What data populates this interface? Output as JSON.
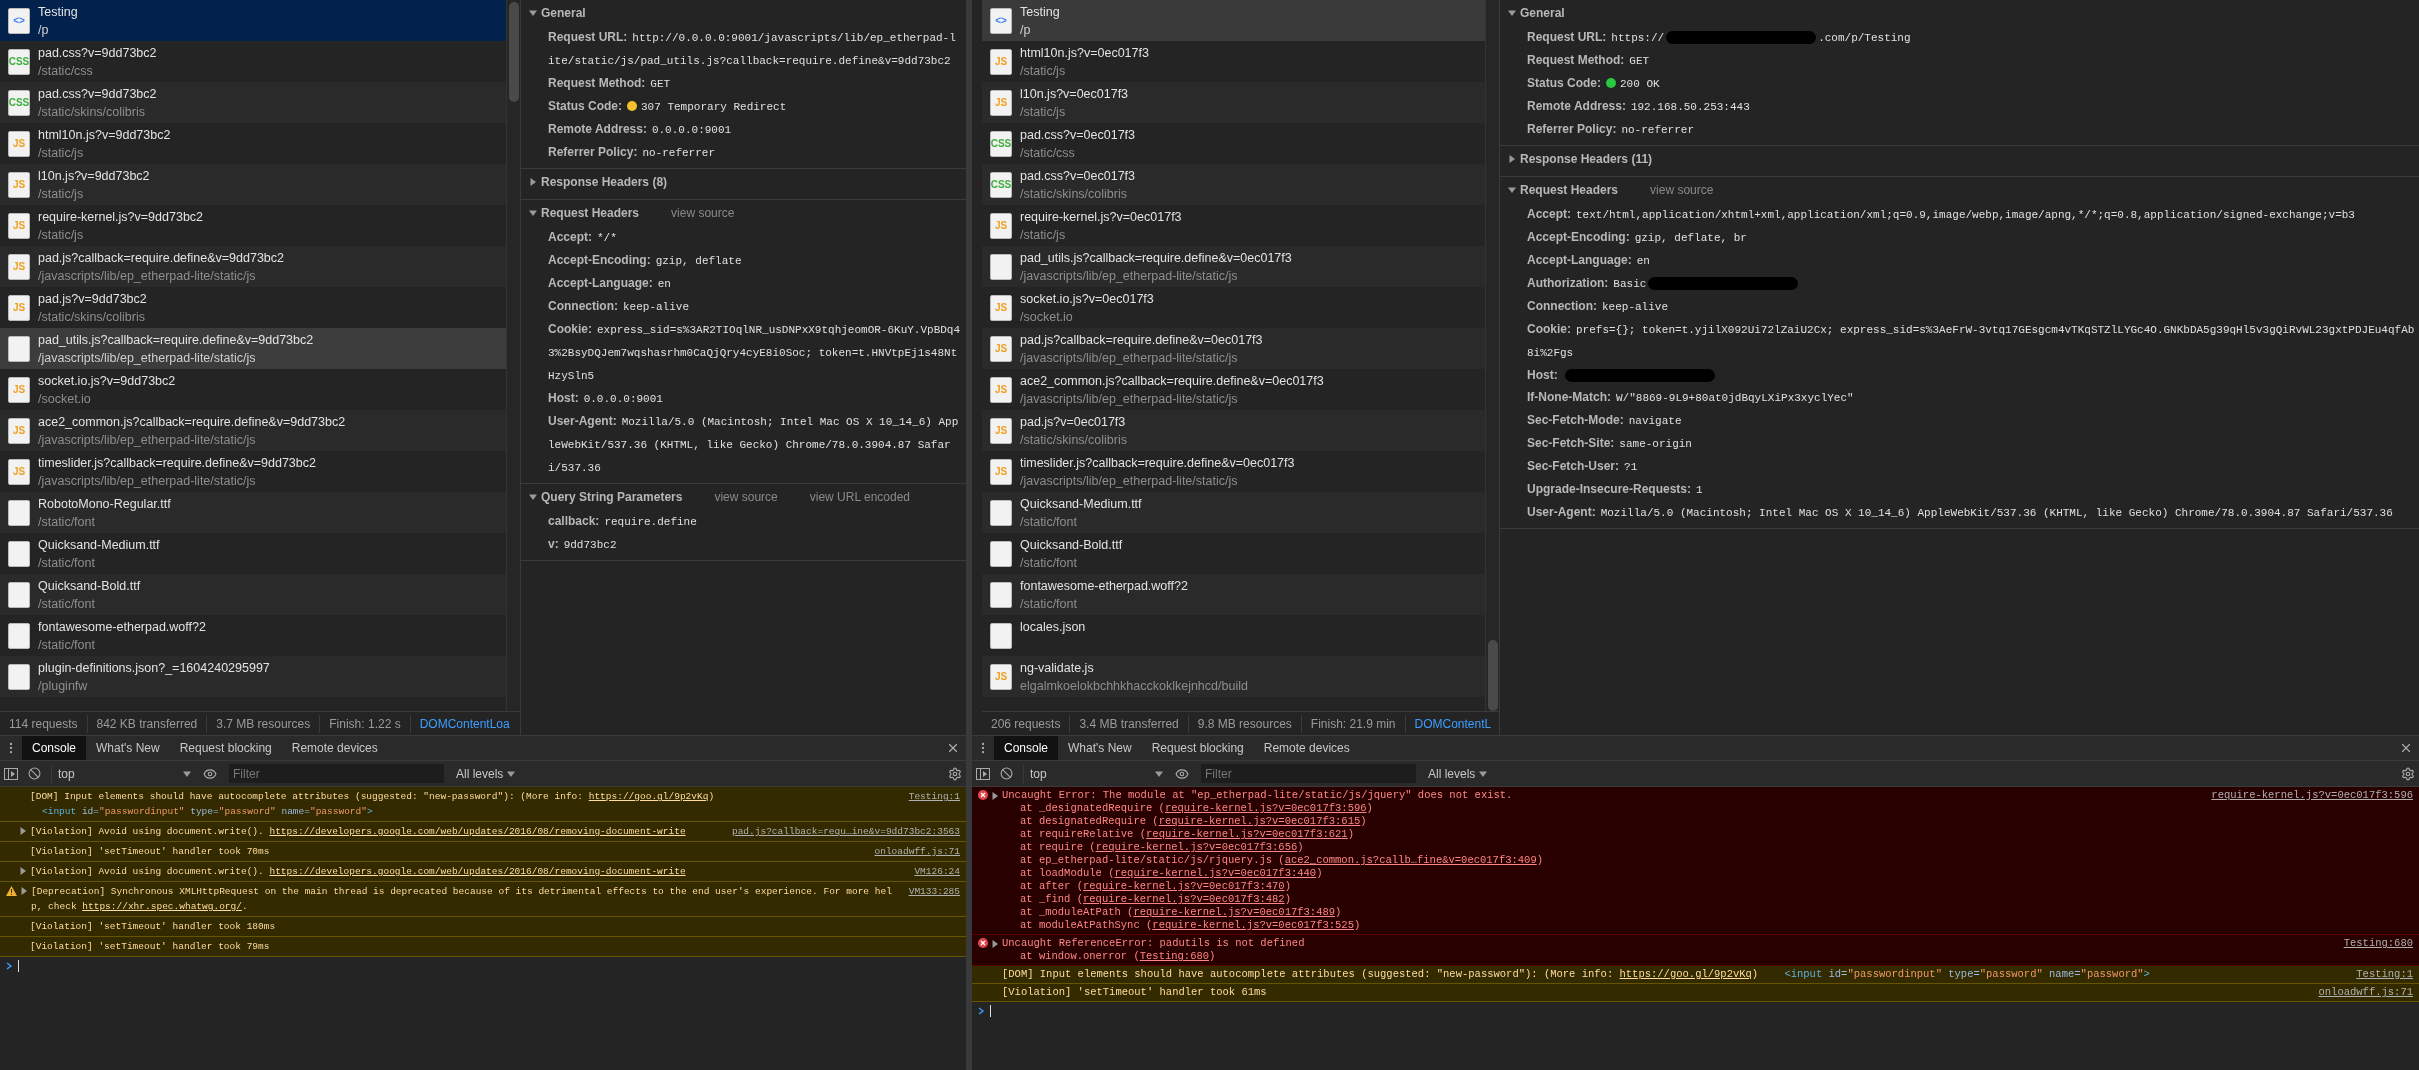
{
  "panes": [
    {
      "list_focused": true,
      "requests": [
        {
          "name": "Testing",
          "path": "/p",
          "kind": "html",
          "icon_label": "<>",
          "selected": true,
          "hovered": false
        },
        {
          "name": "pad.css?v=9dd73bc2",
          "path": "/static/css",
          "kind": "css",
          "icon_label": "CSS",
          "selected": false,
          "hovered": false
        },
        {
          "name": "pad.css?v=9dd73bc2",
          "path": "/static/skins/colibris",
          "kind": "css",
          "icon_label": "CSS",
          "selected": false,
          "hovered": false
        },
        {
          "name": "html10n.js?v=9dd73bc2",
          "path": "/static/js",
          "kind": "js",
          "icon_label": "JS",
          "selected": false,
          "hovered": false
        },
        {
          "name": "l10n.js?v=9dd73bc2",
          "path": "/static/js",
          "kind": "js",
          "icon_label": "JS",
          "selected": false,
          "hovered": false
        },
        {
          "name": "require-kernel.js?v=9dd73bc2",
          "path": "/static/js",
          "kind": "js",
          "icon_label": "JS",
          "selected": false,
          "hovered": false
        },
        {
          "name": "pad.js?callback=require.define&v=9dd73bc2",
          "path": "/javascripts/lib/ep_etherpad-lite/static/js",
          "kind": "js",
          "icon_label": "JS",
          "selected": false,
          "hovered": false
        },
        {
          "name": "pad.js?v=9dd73bc2",
          "path": "/static/skins/colibris",
          "kind": "js",
          "icon_label": "JS",
          "selected": false,
          "hovered": false
        },
        {
          "name": "pad_utils.js?callback=require.define&v=9dd73bc2",
          "path": "/javascripts/lib/ep_etherpad-lite/static/js",
          "kind": "other",
          "selected": false,
          "hovered": true
        },
        {
          "name": "socket.io.js?v=9dd73bc2",
          "path": "/socket.io",
          "kind": "js",
          "icon_label": "JS",
          "selected": false,
          "hovered": false
        },
        {
          "name": "ace2_common.js?callback=require.define&v=9dd73bc2",
          "path": "/javascripts/lib/ep_etherpad-lite/static/js",
          "kind": "js",
          "icon_label": "JS",
          "selected": false,
          "hovered": false
        },
        {
          "name": "timeslider.js?callback=require.define&v=9dd73bc2",
          "path": "/javascripts/lib/ep_etherpad-lite/static/js",
          "kind": "js",
          "icon_label": "JS",
          "selected": false,
          "hovered": false
        },
        {
          "name": "RobotoMono-Regular.ttf",
          "path": "/static/font",
          "kind": "other",
          "selected": false,
          "hovered": false
        },
        {
          "name": "Quicksand-Medium.ttf",
          "path": "/static/font",
          "kind": "other",
          "selected": false,
          "hovered": false
        },
        {
          "name": "Quicksand-Bold.ttf",
          "path": "/static/font",
          "kind": "other",
          "selected": false,
          "hovered": false
        },
        {
          "name": "fontawesome-etherpad.woff?2",
          "path": "/static/font",
          "kind": "other",
          "selected": false,
          "hovered": false
        },
        {
          "name": "plugin-definitions.json?_=1604240295997",
          "path": "/pluginfw",
          "kind": "other",
          "selected": false,
          "hovered": false
        }
      ],
      "summary": [
        "114 requests",
        "842 KB transferred",
        "3.7 MB resources",
        "Finish: 1.22 s"
      ],
      "summary_link": "DOMContentLoa",
      "sections": [
        {
          "title": "General",
          "expanded": true,
          "rows": [
            {
              "key": "Request URL:",
              "value": "http://0.0.0.0:9001/javascripts/lib/ep_etherpad-lite/static/js/pad_utils.js?callback=require.define&v=9dd73bc2"
            },
            {
              "key": "Request Method:",
              "value": "GET"
            },
            {
              "key": "Status Code:",
              "value": "307 Temporary Redirect",
              "color": "#f5c22c"
            },
            {
              "key": "Remote Address:",
              "value": "0.0.0.0:9001"
            },
            {
              "key": "Referrer Policy:",
              "value": "no-referrer"
            }
          ]
        },
        {
          "title": "Response Headers (8)",
          "expanded": false
        },
        {
          "title": "Request Headers",
          "expanded": true,
          "links": [
            "view source"
          ],
          "rows": [
            {
              "key": "Accept:",
              "value": "*/*"
            },
            {
              "key": "Accept-Encoding:",
              "value": "gzip, deflate"
            },
            {
              "key": "Accept-Language:",
              "value": "en"
            },
            {
              "key": "Connection:",
              "value": "keep-alive"
            },
            {
              "key": "Cookie:",
              "value": "express_sid=s%3AR2TIOqlNR_usDNPxX9tqhjeomOR-6KuY.VpBDq43%2BsyDQJem7wqshasrhm0CaQjQry4cyE8i0Soc; token=t.HNVtpEj1s48NtHzySln5"
            },
            {
              "key": "Host:",
              "value": "0.0.0.0:9001"
            },
            {
              "key": "User-Agent:",
              "value": "Mozilla/5.0 (Macintosh; Intel Mac OS X 10_14_6) AppleWebKit/537.36 (KHTML, like Gecko) Chrome/78.0.3904.87 Safari/537.36"
            }
          ]
        },
        {
          "title": "Query String Parameters",
          "expanded": true,
          "links": [
            "view source",
            "view URL encoded"
          ],
          "rows": [
            {
              "key": "callback:",
              "value": "require.define"
            },
            {
              "key": "v:",
              "value": "9dd73bc2"
            }
          ]
        }
      ],
      "console": {
        "tabs": [
          {
            "label": "Console",
            "selected": true
          },
          {
            "label": "What's New",
            "selected": false
          },
          {
            "label": "Request blocking",
            "selected": false
          },
          {
            "label": "Remote devices",
            "selected": false
          }
        ],
        "context": "top",
        "filter_placeholder": "Filter",
        "levels": "All levels",
        "messages": [
          {
            "kind": "warning",
            "expandable": false,
            "source": "Testing:1",
            "lines": [
              {
                "kind": "main",
                "segments": [
                  {
                    "kind": "text",
                    "text": "[DOM] Input elements should have autocomplete attributes (suggested: \"new-password\"): (More info: "
                  },
                  {
                    "kind": "link",
                    "text": "https://goo.gl/9p2vKq"
                  },
                  {
                    "kind": "text",
                    "text": ")"
                  }
                ]
              },
              {
                "kind": "detail",
                "segments": [
                  {
                    "kind": "tag",
                    "text": "<input"
                  },
                  {
                    "kind": "attr",
                    "text": "id="
                  },
                  {
                    "kind": "value",
                    "text": "\"passwordinput\""
                  },
                  {
                    "kind": "attr",
                    "text": "type="
                  },
                  {
                    "kind": "value",
                    "text": "\"password\""
                  },
                  {
                    "kind": "attr",
                    "text": "name="
                  },
                  {
                    "kind": "value",
                    "text": "\"password\""
                  },
                  {
                    "kind": "tag",
                    "text": ">"
                  }
                ]
              }
            ]
          },
          {
            "kind": "warning",
            "expandable": true,
            "source": "pad.js?callback=requ…ine&v=9dd73bc2:3563",
            "lines": [
              {
                "kind": "main",
                "segments": [
                  {
                    "kind": "text",
                    "text": "[Violation] Avoid using document.write(). "
                  },
                  {
                    "kind": "link",
                    "text": "https://developers.google.com/web/updates/2016/08/removing-document-write"
                  }
                ]
              }
            ]
          },
          {
            "kind": "warning",
            "expandable": false,
            "source": "onloadwff.js:71",
            "lines": [
              {
                "kind": "main",
                "segments": [
                  {
                    "kind": "text",
                    "text": "[Violation] 'setTimeout' handler took 70ms"
                  }
                ]
              }
            ]
          },
          {
            "kind": "warning",
            "expandable": true,
            "source": "VM126:24",
            "lines": [
              {
                "kind": "main",
                "segments": [
                  {
                    "kind": "text",
                    "text": "[Violation] Avoid using document.write(). "
                  },
                  {
                    "kind": "link",
                    "text": "https://developers.google.com/web/updates/2016/08/removing-document-write"
                  }
                ]
              }
            ]
          },
          {
            "kind": "deprecation",
            "expandable": true,
            "source": "VM133:285",
            "lines": [
              {
                "kind": "main",
                "segments": [
                  {
                    "kind": "text",
                    "text": "[Deprecation] Synchronous XMLHttpRequest on the main thread is deprecated because of its detrimental effects to the end user's experience. For more help, check "
                  },
                  {
                    "kind": "link",
                    "text": "https://xhr.spec.whatwg.org/"
                  },
                  {
                    "kind": "text",
                    "text": "."
                  }
                ]
              }
            ]
          },
          {
            "kind": "warning",
            "expandable": false,
            "lines": [
              {
                "kind": "main",
                "segments": [
                  {
                    "kind": "text",
                    "text": "[Violation] 'setTimeout' handler took 180ms"
                  }
                ]
              }
            ]
          },
          {
            "kind": "warning",
            "expandable": false,
            "lines": [
              {
                "kind": "main",
                "segments": [
                  {
                    "kind": "text",
                    "text": "[Violation] 'setTimeout' handler took 79ms"
                  }
                ]
              }
            ]
          }
        ]
      }
    },
    {
      "list_focused": false,
      "requests": [
        {
          "name": "Testing",
          "path": "/p",
          "kind": "html",
          "icon_label": "<>",
          "selected": true,
          "hovered": false
        },
        {
          "name": "html10n.js?v=0ec017f3",
          "path": "/static/js",
          "kind": "js",
          "icon_label": "JS",
          "selected": false,
          "hovered": false
        },
        {
          "name": "l10n.js?v=0ec017f3",
          "path": "/static/js",
          "kind": "js",
          "icon_label": "JS",
          "selected": false,
          "hovered": false
        },
        {
          "name": "pad.css?v=0ec017f3",
          "path": "/static/css",
          "kind": "css",
          "icon_label": "CSS",
          "selected": false,
          "hovered": false
        },
        {
          "name": "pad.css?v=0ec017f3",
          "path": "/static/skins/colibris",
          "kind": "css",
          "icon_label": "CSS",
          "selected": false,
          "hovered": false
        },
        {
          "name": "require-kernel.js?v=0ec017f3",
          "path": "/static/js",
          "kind": "js",
          "icon_label": "JS",
          "selected": false,
          "hovered": false
        },
        {
          "name": "pad_utils.js?callback=require.define&v=0ec017f3",
          "path": "/javascripts/lib/ep_etherpad-lite/static/js",
          "kind": "other",
          "selected": false,
          "hovered": false
        },
        {
          "name": "socket.io.js?v=0ec017f3",
          "path": "/socket.io",
          "kind": "js",
          "icon_label": "JS",
          "selected": false,
          "hovered": false
        },
        {
          "name": "pad.js?callback=require.define&v=0ec017f3",
          "path": "/javascripts/lib/ep_etherpad-lite/static/js",
          "kind": "js",
          "icon_label": "JS",
          "selected": false,
          "hovered": false
        },
        {
          "name": "ace2_common.js?callback=require.define&v=0ec017f3",
          "path": "/javascripts/lib/ep_etherpad-lite/static/js",
          "kind": "js",
          "icon_label": "JS",
          "selected": false,
          "hovered": false
        },
        {
          "name": "pad.js?v=0ec017f3",
          "path": "/static/skins/colibris",
          "kind": "js",
          "icon_label": "JS",
          "selected": false,
          "hovered": false
        },
        {
          "name": "timeslider.js?callback=require.define&v=0ec017f3",
          "path": "/javascripts/lib/ep_etherpad-lite/static/js",
          "kind": "js",
          "icon_label": "JS",
          "selected": false,
          "hovered": false
        },
        {
          "name": "Quicksand-Medium.ttf",
          "path": "/static/font",
          "kind": "other",
          "selected": false,
          "hovered": false
        },
        {
          "name": "Quicksand-Bold.ttf",
          "path": "/static/font",
          "kind": "other",
          "selected": false,
          "hovered": false
        },
        {
          "name": "fontawesome-etherpad.woff?2",
          "path": "/static/font",
          "kind": "other",
          "selected": false,
          "hovered": false
        },
        {
          "name": "locales.json",
          "kind": "other",
          "selected": false,
          "hovered": false
        },
        {
          "name": "ng-validate.js",
          "path": "elgalmkoelokbchhkhacckoklkejnhcd/build",
          "kind": "js",
          "icon_label": "JS",
          "selected": false,
          "hovered": false
        }
      ],
      "summary": [
        "206 requests",
        "3.4 MB transferred",
        "9.8 MB resources",
        "Finish: 21.9 min"
      ],
      "summary_link": "DOMContentL",
      "sections": [
        {
          "title": "General",
          "expanded": true,
          "rows": [
            {
              "key": "Request URL:",
              "parts": [
                {
                  "kind": "text",
                  "text": "https://"
                },
                {
                  "kind": "redacted"
                },
                {
                  "kind": "text",
                  "text": ".com/p/Testing"
                }
              ]
            },
            {
              "key": "Request Method:",
              "value": "GET"
            },
            {
              "key": "Status Code:",
              "value": "200 OK",
              "color": "#27c93f"
            },
            {
              "key": "Remote Address:",
              "value": "192.168.50.253:443"
            },
            {
              "key": "Referrer Policy:",
              "value": "no-referrer"
            }
          ]
        },
        {
          "title": "Response Headers (11)",
          "expanded": false
        },
        {
          "title": "Request Headers",
          "expanded": true,
          "links": [
            "view source"
          ],
          "rows": [
            {
              "key": "Accept:",
              "value": "text/html,application/xhtml+xml,application/xml;q=0.9,image/webp,image/apng,*/*;q=0.8,application/signed-exchange;v=b3"
            },
            {
              "key": "Accept-Encoding:",
              "value": "gzip, deflate, br"
            },
            {
              "key": "Accept-Language:",
              "value": "en"
            },
            {
              "key": "Authorization:",
              "parts": [
                {
                  "kind": "text",
                  "text": "Basic"
                },
                {
                  "kind": "redacted"
                }
              ]
            },
            {
              "key": "Connection:",
              "value": "keep-alive"
            },
            {
              "key": "Cookie:",
              "value": "prefs={}; token=t.yjilX092Ui72lZaiU2Cx; express_sid=s%3AeFrW-3vtq17GEsgcm4vTKqSTZlLYGc4O.GNKbDA5g39qHl5v3gQiRvWL23gxtPDJEu4qfAb8i%2Fgs"
            },
            {
              "key": "Host:",
              "parts": [
                {
                  "kind": "redacted"
                }
              ]
            },
            {
              "key": "If-None-Match:",
              "value": "W/\"8869-9L9+80at0jdBqyLXiPx3xyclYec\""
            },
            {
              "key": "Sec-Fetch-Mode:",
              "value": "navigate"
            },
            {
              "key": "Sec-Fetch-Site:",
              "value": "same-origin"
            },
            {
              "key": "Sec-Fetch-User:",
              "value": "?1"
            },
            {
              "key": "Upgrade-Insecure-Requests:",
              "value": "1"
            },
            {
              "key": "User-Agent:",
              "value": "Mozilla/5.0 (Macintosh; Intel Mac OS X 10_14_6) AppleWebKit/537.36 (KHTML, like Gecko) Chrome/78.0.3904.87 Safari/537.36"
            }
          ]
        }
      ],
      "console": {
        "tabs": [
          {
            "label": "Console",
            "selected": true
          },
          {
            "label": "What's New",
            "selected": false
          },
          {
            "label": "Request blocking",
            "selected": false
          },
          {
            "label": "Remote devices",
            "selected": false
          }
        ],
        "context": "top",
        "filter_placeholder": "Filter",
        "levels": "All levels",
        "messages": [
          {
            "kind": "error",
            "expandable": true,
            "source": "require-kernel.js?v=0ec017f3:596",
            "lines": [
              {
                "kind": "main",
                "segments": [
                  {
                    "kind": "text",
                    "text": "Uncaught Error: The module at \"ep_etherpad-lite/static/js/jquery\" does not exist."
                  }
                ]
              },
              {
                "kind": "detail",
                "segments": [
                  {
                    "kind": "text",
                    "text": "at _designatedRequire ("
                  },
                  {
                    "kind": "link",
                    "text": "require-kernel.js?v=0ec017f3:596"
                  },
                  {
                    "kind": "text",
                    "text": ")"
                  }
                ]
              },
              {
                "kind": "detail",
                "segments": [
                  {
                    "kind": "text",
                    "text": "at designatedRequire ("
                  },
                  {
                    "kind": "link",
                    "text": "require-kernel.js?v=0ec017f3:615"
                  },
                  {
                    "kind": "text",
                    "text": ")"
                  }
                ]
              },
              {
                "kind": "detail",
                "segments": [
                  {
                    "kind": "text",
                    "text": "at requireRelative ("
                  },
                  {
                    "kind": "link",
                    "text": "require-kernel.js?v=0ec017f3:621"
                  },
                  {
                    "kind": "text",
                    "text": ")"
                  }
                ]
              },
              {
                "kind": "detail",
                "segments": [
                  {
                    "kind": "text",
                    "text": "at require ("
                  },
                  {
                    "kind": "link",
                    "text": "require-kernel.js?v=0ec017f3:656"
                  },
                  {
                    "kind": "text",
                    "text": ")"
                  }
                ]
              },
              {
                "kind": "detail",
                "segments": [
                  {
                    "kind": "text",
                    "text": "at ep_etherpad-lite/static/js/rjquery.js ("
                  },
                  {
                    "kind": "link",
                    "text": "ace2_common.js?callb…fine&v=0ec017f3:409"
                  },
                  {
                    "kind": "text",
                    "text": ")"
                  }
                ]
              },
              {
                "kind": "detail",
                "segments": [
                  {
                    "kind": "text",
                    "text": "at loadModule ("
                  },
                  {
                    "kind": "link",
                    "text": "require-kernel.js?v=0ec017f3:440"
                  },
                  {
                    "kind": "text",
                    "text": ")"
                  }
                ]
              },
              {
                "kind": "detail",
                "segments": [
                  {
                    "kind": "text",
                    "text": "at after ("
                  },
                  {
                    "kind": "link",
                    "text": "require-kernel.js?v=0ec017f3:470"
                  },
                  {
                    "kind": "text",
                    "text": ")"
                  }
                ]
              },
              {
                "kind": "detail",
                "segments": [
                  {
                    "kind": "text",
                    "text": "at _find ("
                  },
                  {
                    "kind": "link",
                    "text": "require-kernel.js?v=0ec017f3:482"
                  },
                  {
                    "kind": "text",
                    "text": ")"
                  }
                ]
              },
              {
                "kind": "detail",
                "segments": [
                  {
                    "kind": "text",
                    "text": "at _moduleAtPath ("
                  },
                  {
                    "kind": "link",
                    "text": "require-kernel.js?v=0ec017f3:489"
                  },
                  {
                    "kind": "text",
                    "text": ")"
                  }
                ]
              },
              {
                "kind": "detail",
                "segments": [
                  {
                    "kind": "text",
                    "text": "at moduleAtPathSync ("
                  },
                  {
                    "kind": "link",
                    "text": "require-kernel.js?v=0ec017f3:525"
                  },
                  {
                    "kind": "text",
                    "text": ")"
                  }
                ]
              }
            ]
          },
          {
            "kind": "error",
            "expandable": true,
            "source": "Testing:680",
            "lines": [
              {
                "kind": "main",
                "segments": [
                  {
                    "kind": "text",
                    "text": "Uncaught ReferenceError: padutils is not defined"
                  }
                ]
              },
              {
                "kind": "detail",
                "segments": [
                  {
                    "kind": "text",
                    "text": "at window.onerror ("
                  },
                  {
                    "kind": "link",
                    "text": "Testing:680"
                  },
                  {
                    "kind": "text",
                    "text": ")"
                  }
                ]
              }
            ]
          },
          {
            "kind": "warning",
            "expandable": false,
            "source": "Testing:1",
            "lines": [
              {
                "kind": "main",
                "segments": [
                  {
                    "kind": "text",
                    "text": "[DOM] Input elements should have autocomplete attributes (suggested: \"new-password\"): (More info: "
                  },
                  {
                    "kind": "link",
                    "text": "https://goo.gl/9p2vKq"
                  },
                  {
                    "kind": "text",
                    "text": ")"
                  },
                  {
                    "kind": "tag",
                    "text": "<input"
                  },
                  {
                    "kind": "attr",
                    "text": "id="
                  },
                  {
                    "kind": "value",
                    "text": "\"passwordinput\""
                  },
                  {
                    "kind": "attr",
                    "text": "type="
                  },
                  {
                    "kind": "value",
                    "text": "\"password\""
                  },
                  {
                    "kind": "attr",
                    "text": "name="
                  },
                  {
                    "kind": "value",
                    "text": "\"password\""
                  },
                  {
                    "kind": "tag",
                    "text": ">"
                  }
                ]
              }
            ]
          },
          {
            "kind": "warning",
            "expandable": false,
            "source": "onloadwff.js:71",
            "lines": [
              {
                "kind": "main",
                "segments": [
                  {
                    "kind": "text",
                    "text": "[Violation] 'setTimeout' handler took 61ms"
                  }
                ]
              }
            ]
          }
        ]
      }
    }
  ]
}
